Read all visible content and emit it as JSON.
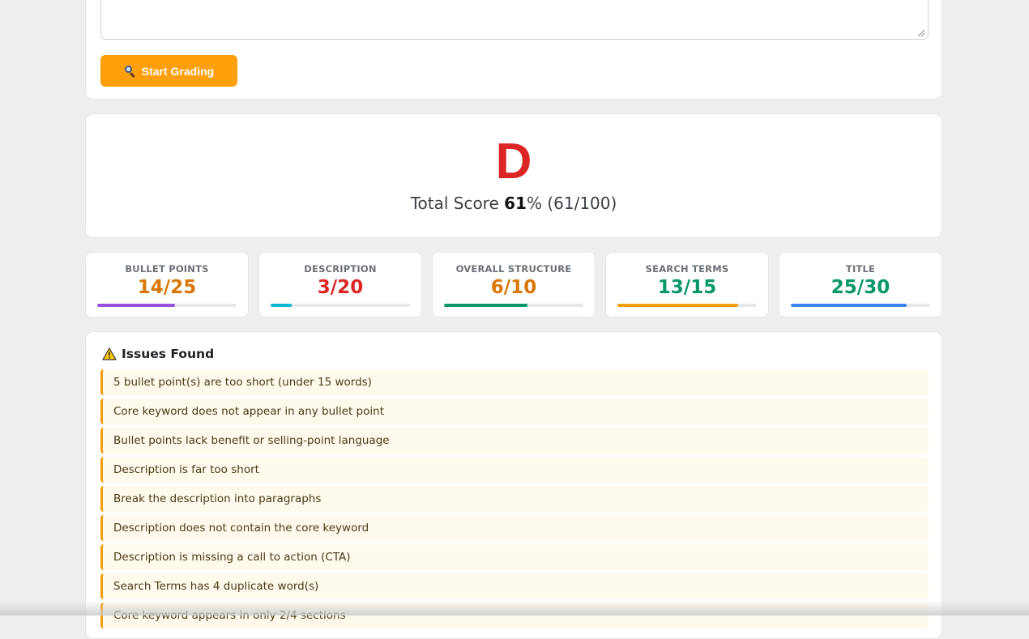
{
  "grader": {
    "start_button_label": "Start Grading",
    "start_button_icon": "magnifier-icon"
  },
  "score": {
    "grade": "D",
    "total_prefix": "Total Score ",
    "total_percent": "61",
    "total_suffix": "% (61/100)",
    "grade_color": "#dc2626"
  },
  "metrics": [
    {
      "label": "BULLET POINTS",
      "value": "14/25",
      "score": 14,
      "max": 25,
      "value_color": "#d97706",
      "bar_color": "#9b51e0"
    },
    {
      "label": "DESCRIPTION",
      "value": "3/20",
      "score": 3,
      "max": 20,
      "value_color": "#dc2626",
      "bar_color": "#06b6d4"
    },
    {
      "label": "OVERALL STRUCTURE",
      "value": "6/10",
      "score": 6,
      "max": 10,
      "value_color": "#d97706",
      "bar_color": "#059669"
    },
    {
      "label": "SEARCH TERMS",
      "value": "13/15",
      "score": 13,
      "max": 15,
      "value_color": "#059669",
      "bar_color": "#f59e0b"
    },
    {
      "label": "TITLE",
      "value": "25/30",
      "score": 25,
      "max": 30,
      "value_color": "#059669",
      "bar_color": "#3b82f6"
    }
  ],
  "issues": {
    "title": "Issues Found",
    "icon": "warning-icon",
    "items": [
      "5 bullet point(s) are too short (under 15 words)",
      "Core keyword does not appear in any bullet point",
      "Bullet points lack benefit or selling-point language",
      "Description is far too short",
      "Break the description into paragraphs",
      "Description does not contain the core keyword",
      "Description is missing a call to action (CTA)",
      "Search Terms has 4 duplicate word(s)",
      "Core keyword appears in only 2/4 sections"
    ]
  }
}
